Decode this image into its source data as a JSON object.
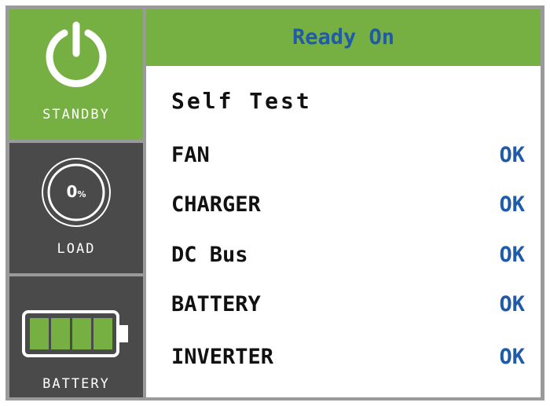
{
  "sidebar": {
    "standby_label": "STANDBY",
    "load_label": "LOAD",
    "load_value": "0",
    "load_unit": "%",
    "battery_label": "BATTERY",
    "battery_level_fraction": 1.0,
    "standby_icon": "power-icon",
    "load_icon": "load-gauge-icon",
    "battery_icon": "battery-icon"
  },
  "header": {
    "status": "Ready On"
  },
  "self_test": {
    "title": "Self Test",
    "items": [
      {
        "label": "FAN",
        "status": "OK"
      },
      {
        "label": "CHARGER",
        "status": "OK"
      },
      {
        "label": "DC Bus",
        "status": "OK"
      },
      {
        "label": "BATTERY",
        "status": "OK"
      },
      {
        "label": "INVERTER",
        "status": "OK"
      }
    ]
  },
  "colors": {
    "accent_green": "#76b043",
    "status_blue": "#1f5ba8",
    "tile_dark": "#4a4a4a",
    "battery_fill": "#76b043"
  }
}
